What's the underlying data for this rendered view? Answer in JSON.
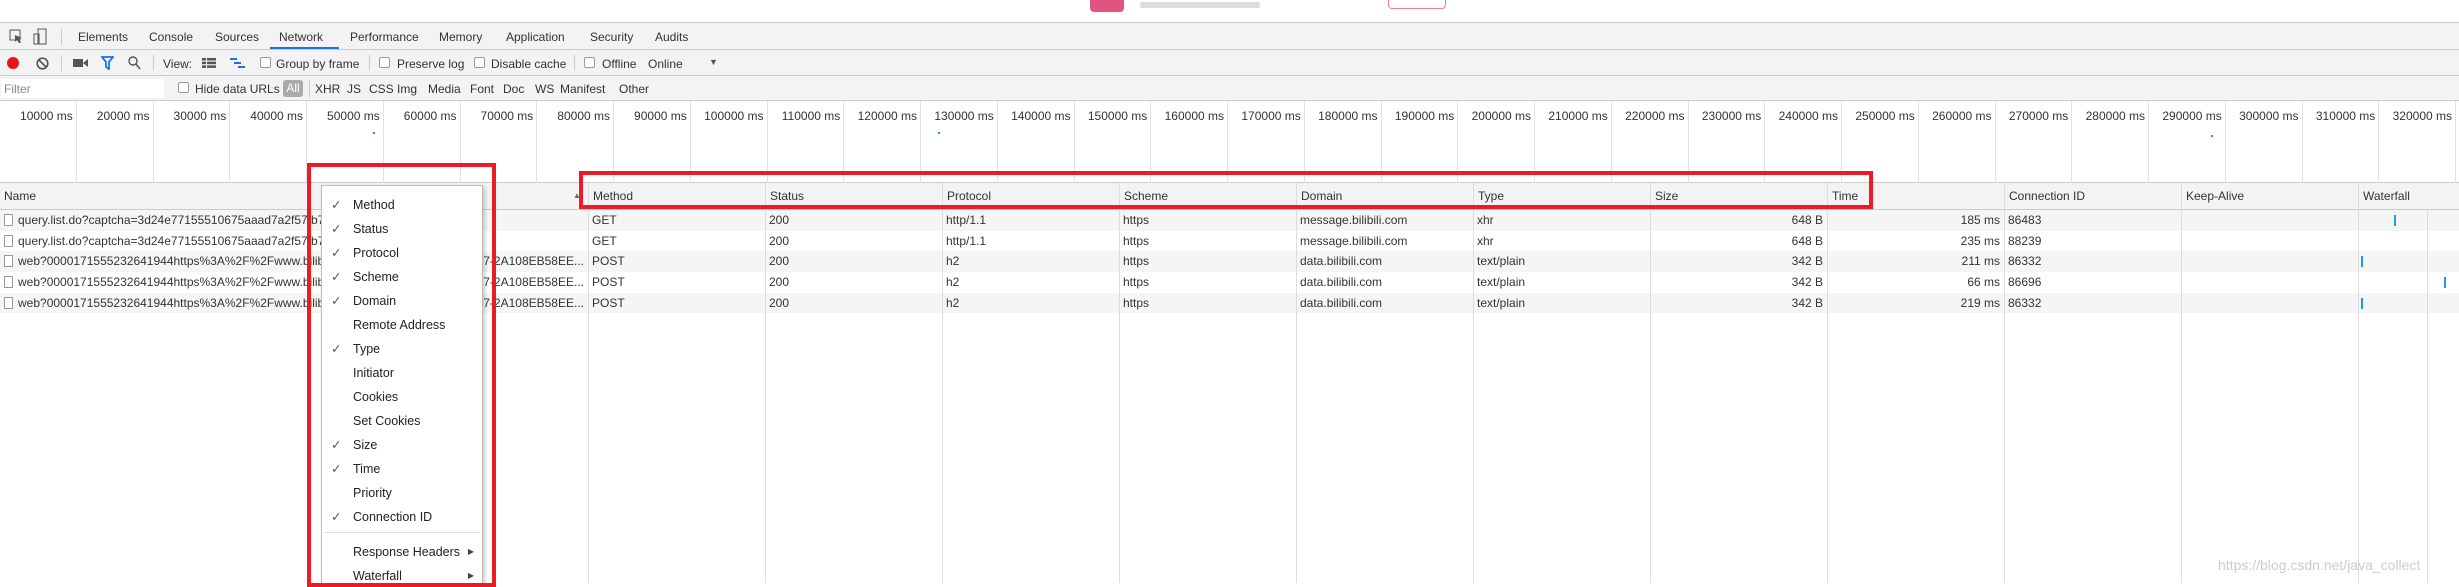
{
  "devtools": {
    "tabs": [
      "Elements",
      "Console",
      "Sources",
      "Network",
      "Performance",
      "Memory",
      "Application",
      "Security",
      "Audits"
    ],
    "active_tab": "Network",
    "accent_color": "#1a73e8"
  },
  "toolbar": {
    "view_label": "View:",
    "group_by_frame": "Group by frame",
    "preserve_log": "Preserve log",
    "disable_cache": "Disable cache",
    "offline": "Offline",
    "throttling": "Online",
    "record_color": "#e8141c"
  },
  "filterbar": {
    "placeholder": "Filter",
    "hide_data_urls": "Hide data URLs",
    "types": [
      "All",
      "XHR",
      "JS",
      "CSS",
      "Img",
      "Media",
      "Font",
      "Doc",
      "WS",
      "Manifest",
      "Other"
    ],
    "selected_type": "All"
  },
  "timeline": {
    "ticks": [
      "10000 ms",
      "20000 ms",
      "30000 ms",
      "40000 ms",
      "50000 ms",
      "60000 ms",
      "70000 ms",
      "80000 ms",
      "90000 ms",
      "100000 ms",
      "110000 ms",
      "120000 ms",
      "130000 ms",
      "140000 ms",
      "150000 ms",
      "160000 ms",
      "170000 ms",
      "180000 ms",
      "190000 ms",
      "200000 ms",
      "210000 ms",
      "220000 ms",
      "230000 ms",
      "240000 ms",
      "250000 ms",
      "260000 ms",
      "270000 ms",
      "280000 ms",
      "290000 ms",
      "300000 ms",
      "310000 ms",
      "320000 ms"
    ]
  },
  "table": {
    "columns": [
      "Name",
      "Method",
      "Status",
      "Protocol",
      "Scheme",
      "Domain",
      "Type",
      "Size",
      "Time",
      "Connection ID",
      "Keep-Alive",
      "Waterfall"
    ],
    "rows": [
      {
        "name": "query.list.do?captcha=3d24e77155510675aaad7a2f57 b7",
        "name_end": "",
        "method": "GET",
        "status": "200",
        "protocol": "http/1.1",
        "scheme": "https",
        "domain": "message.bilibili.com",
        "type": "xhr",
        "size": "648 B",
        "time": "185 ms",
        "connection_id": "86483",
        "keep_alive": ""
      },
      {
        "name": "query.list.do?captcha=3d24e77155510675aaad7a2f57 b7",
        "name_end": "",
        "method": "GET",
        "status": "200",
        "protocol": "http/1.1",
        "scheme": "https",
        "domain": "message.bilibili.com",
        "type": "xhr",
        "size": "648 B",
        "time": "235 ms",
        "connection_id": "88239",
        "keep_alive": ""
      },
      {
        "name": "web?0000171555232641944https%3A%2F%2Fwww.bilibi",
        "name_end": "57-2A108EB58EE...",
        "method": "POST",
        "status": "200",
        "protocol": "h2",
        "scheme": "https",
        "domain": "data.bilibili.com",
        "type": "text/plain",
        "size": "342 B",
        "time": "211 ms",
        "connection_id": "86332",
        "keep_alive": ""
      },
      {
        "name": "web?0000171555232641944https%3A%2F%2Fwww.bilibi",
        "name_end": "57-2A108EB58EE...",
        "method": "POST",
        "status": "200",
        "protocol": "h2",
        "scheme": "https",
        "domain": "data.bilibili.com",
        "type": "text/plain",
        "size": "342 B",
        "time": "66 ms",
        "connection_id": "86696",
        "keep_alive": ""
      },
      {
        "name": "web?0000171555232641944https%3A%2F%2Fwww.bilibi",
        "name_end": "57-2A108EB58EE...",
        "method": "POST",
        "status": "200",
        "protocol": "h2",
        "scheme": "https",
        "domain": "data.bilibili.com",
        "type": "text/plain",
        "size": "342 B",
        "time": "219 ms",
        "connection_id": "86332",
        "keep_alive": ""
      }
    ]
  },
  "context_menu": {
    "items": [
      {
        "label": "Method",
        "checked": true
      },
      {
        "label": "Status",
        "checked": true
      },
      {
        "label": "Protocol",
        "checked": true
      },
      {
        "label": "Scheme",
        "checked": true
      },
      {
        "label": "Domain",
        "checked": true
      },
      {
        "label": "Remote Address",
        "checked": false
      },
      {
        "label": "Type",
        "checked": true
      },
      {
        "label": "Initiator",
        "checked": false
      },
      {
        "label": "Cookies",
        "checked": false
      },
      {
        "label": "Set Cookies",
        "checked": false
      },
      {
        "label": "Size",
        "checked": true
      },
      {
        "label": "Time",
        "checked": true
      },
      {
        "label": "Priority",
        "checked": false
      },
      {
        "label": "Connection ID",
        "checked": true
      }
    ],
    "submenus": [
      "Response Headers",
      "Waterfall"
    ]
  },
  "annotation_color": "#ec1c24",
  "watermark": "https://blog.csdn.net/java_collect"
}
